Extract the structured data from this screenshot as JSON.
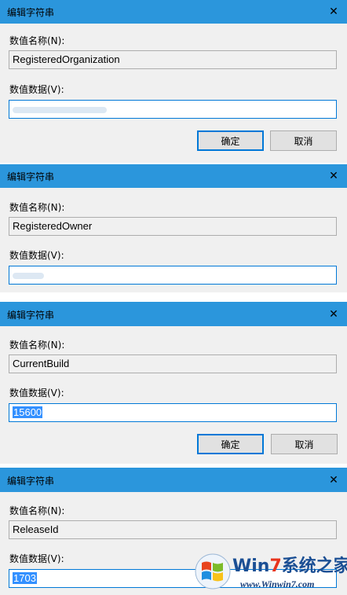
{
  "dialogs": [
    {
      "title": "编辑字符串",
      "value_name_label": "数值名称(N):",
      "value_name": "RegisteredOrganization",
      "value_data_label": "数值数据(V):",
      "value_data": "",
      "ok_label": "确定",
      "cancel_label": "取消"
    },
    {
      "title": "编辑字符串",
      "value_name_label": "数值名称(N):",
      "value_name": "RegisteredOwner",
      "value_data_label": "数值数据(V):",
      "value_data": ""
    },
    {
      "title": "编辑字符串",
      "value_name_label": "数值名称(N):",
      "value_name": "CurrentBuild",
      "value_data_label": "数值数据(V):",
      "value_data": "15600",
      "ok_label": "确定",
      "cancel_label": "取消"
    },
    {
      "title": "编辑字符串",
      "value_name_label": "数值名称(N):",
      "value_name": "ReleaseId",
      "value_data_label": "数值数据(V):",
      "value_data": "1703"
    }
  ],
  "watermark": {
    "brand_prefix": "Win",
    "brand_seven": "7",
    "brand_suffix": "系统之家",
    "url": "www.Winwin7.com"
  },
  "colors": {
    "titlebar": "#2b96dc",
    "dialog_bg": "#f0f0f0",
    "field_focus_border": "#0078d7",
    "selection": "#3390ff"
  },
  "icons": [
    "close-icon",
    "windows-logo-icon"
  ]
}
